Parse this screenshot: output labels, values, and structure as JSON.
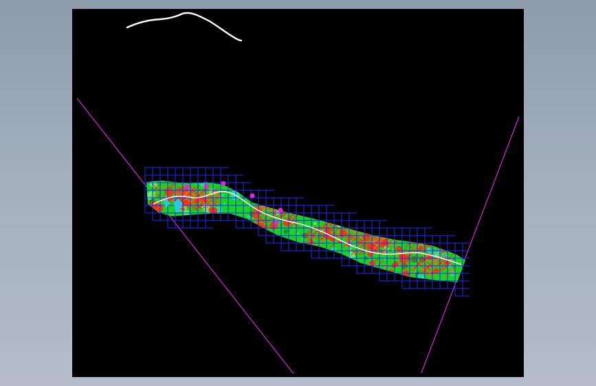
{
  "drawing": {
    "background_color": "#000000",
    "window_background_color": "#9aa6b5",
    "layers": {
      "grid": "#1f2bff",
      "fill_primary": "#19e61f",
      "fill_secondary": "#2ad9a6",
      "hatch_red": "#ff2a10",
      "hatch_orange": "#ff6a1a",
      "accent_magenta": "#e324e3",
      "accent_cyan": "#26c9e6",
      "centerline": "#ffffff",
      "boundary_lines": "#d726d7"
    }
  }
}
